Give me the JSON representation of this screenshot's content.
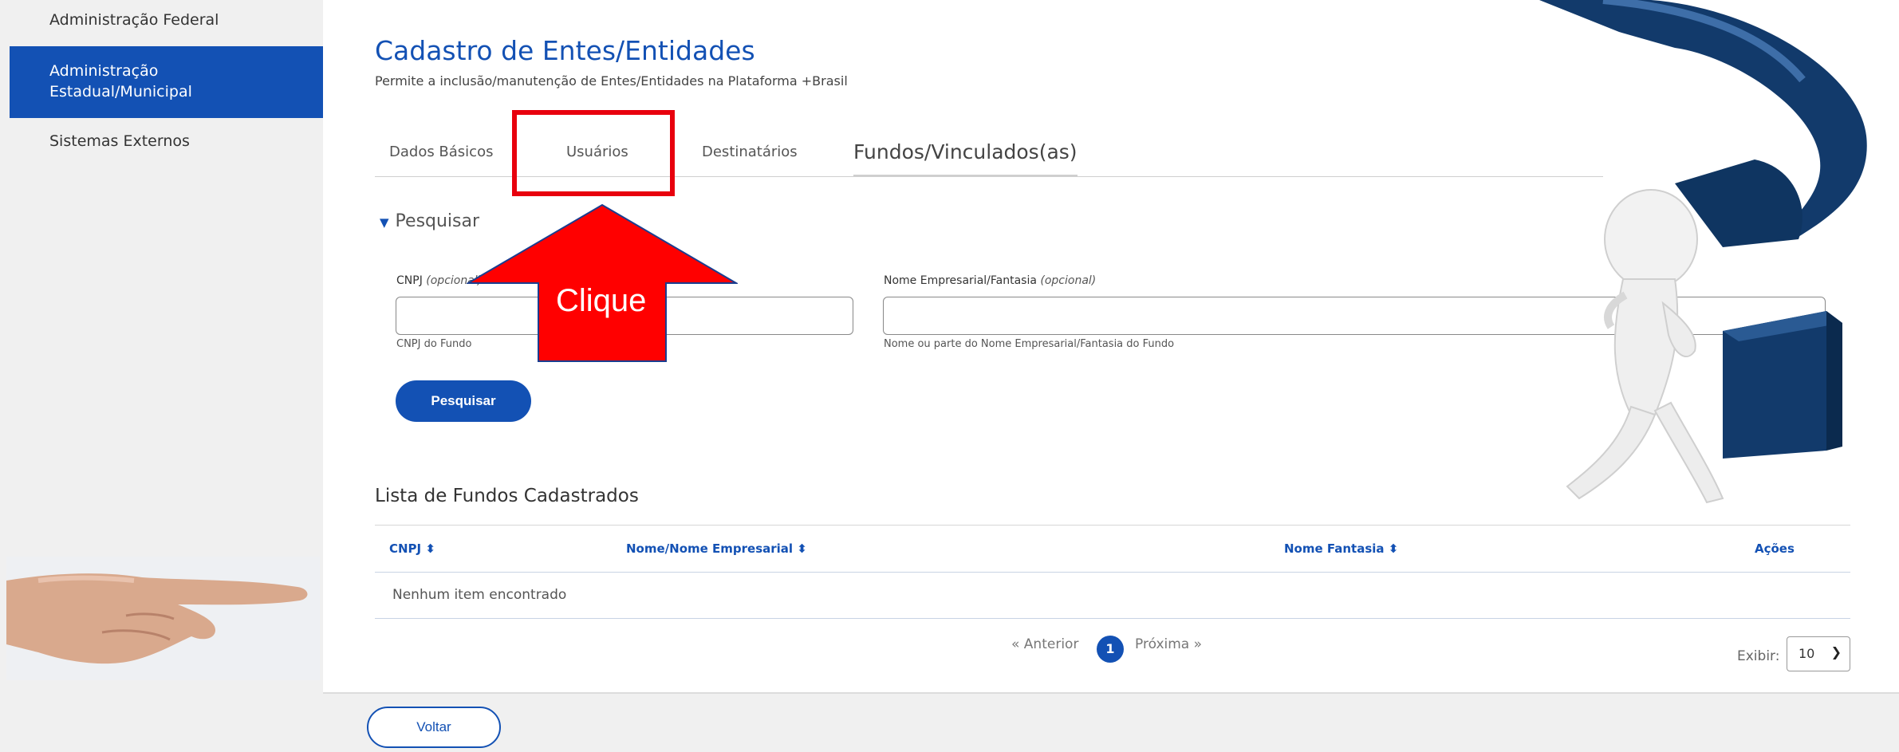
{
  "sidebar": {
    "items": [
      {
        "label": "Administração Federal"
      },
      {
        "label": "Administração Estadual/Municipal"
      },
      {
        "label": "Sistemas Externos"
      }
    ]
  },
  "page": {
    "title": "Cadastro de Entes/Entidades",
    "subtitle": "Permite a inclusão/manutenção de Entes/Entidades na Plataforma +Brasil"
  },
  "tabs": [
    {
      "label": "Dados Básicos"
    },
    {
      "label": "Usuários"
    },
    {
      "label": "Destinatários"
    },
    {
      "label": "Fundos/Vinculados(as)"
    }
  ],
  "search": {
    "toggle_label": "Pesquisar",
    "cnpj": {
      "label": "CNPJ",
      "optional": "(opcional)",
      "value": "",
      "hint": "CNPJ do Fundo"
    },
    "nome": {
      "label": "Nome Empresarial/Fantasia",
      "optional": "(opcional)",
      "value": "",
      "hint": "Nome ou parte do Nome Empresarial/Fantasia do Fundo"
    },
    "button_label": "Pesquisar"
  },
  "list": {
    "title": "Lista de Fundos Cadastrados",
    "columns": [
      "CNPJ ⬍",
      "Nome/Nome Empresarial ⬍",
      "Nome Fantasia ⬍",
      "Ações"
    ],
    "empty_message": "Nenhum item encontrado"
  },
  "pagination": {
    "prev": "« Anterior",
    "current": "1",
    "next": "Próxima »",
    "show_label": "Exibir:",
    "show_value": "10"
  },
  "footer": {
    "back_label": "Voltar"
  },
  "overlay": {
    "callout": "Clique"
  },
  "colors": {
    "primary": "#1351b4",
    "highlight": "#e8000d",
    "arrow": "#ff0000"
  }
}
